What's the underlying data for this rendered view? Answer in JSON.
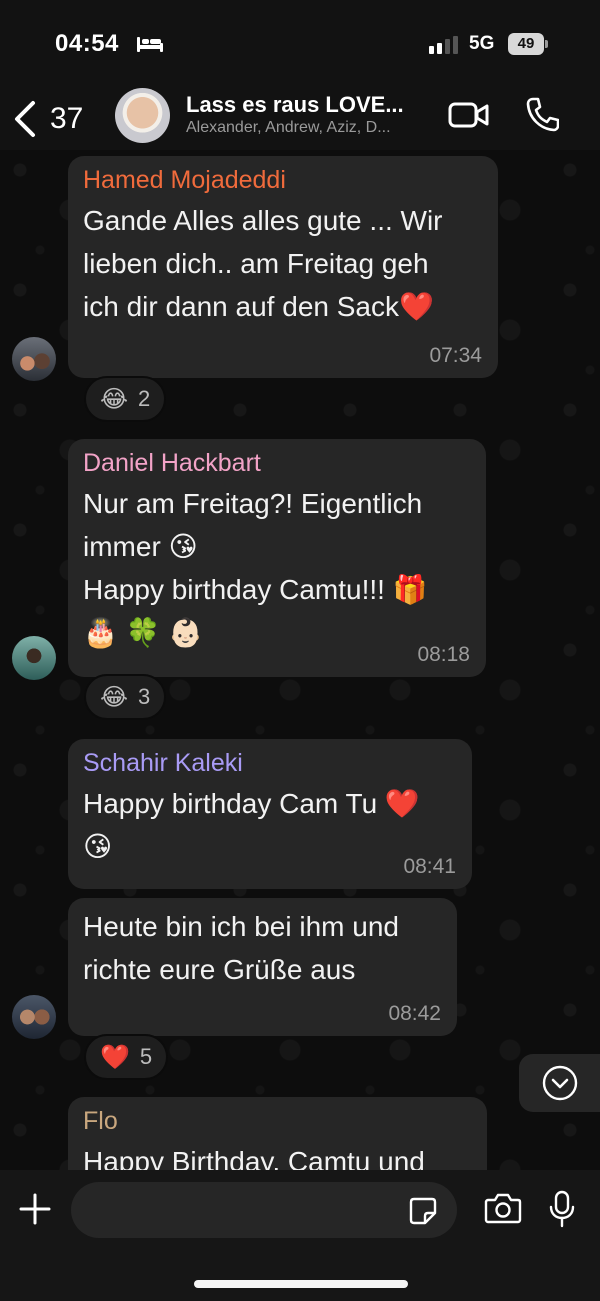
{
  "status": {
    "time": "04:54",
    "network": "5G",
    "battery": "49"
  },
  "header": {
    "back_count": "37",
    "title": "Lass es raus LOVE...",
    "members": "Alexander, Andrew, Aziz, D..."
  },
  "messages": [
    {
      "sender": "Hamed Mojadeddi",
      "sender_color": "#f06b3c",
      "lines": [
        "Gande Alles alles gute ... Wir",
        "lieben dich.. am Freitag geh",
        "ich dir dann auf den Sack❤️"
      ],
      "time": "07:34",
      "reaction": {
        "emoji": "😂",
        "count": "2"
      }
    },
    {
      "sender": "Daniel Hackbart",
      "sender_color": "#f2a3c7",
      "lines": [
        "Nur am Freitag?! Eigentlich",
        "immer 😘",
        "Happy birthday Camtu!!! 🎁",
        "🎂 🍀 👶🏻"
      ],
      "time": "08:18",
      "reaction": {
        "emoji": "😂",
        "count": "3"
      }
    },
    {
      "sender": "Schahir Kaleki",
      "sender_color": "#a99bf5",
      "lines": [
        "Happy birthday Cam Tu ❤️",
        "😘"
      ],
      "time": "08:41"
    },
    {
      "lines": [
        "Heute bin ich bei ihm und",
        "richte eure Grüße aus"
      ],
      "time": "08:42",
      "reaction": {
        "emoji": "❤️",
        "count": "5"
      }
    },
    {
      "sender": "Flo",
      "sender_color": "#c9a77e",
      "lines": [
        "Happy Birthday, Camtu und"
      ]
    }
  ],
  "input": {
    "placeholder": ""
  },
  "icons": {
    "back": "chevron-left-icon",
    "video": "video-camera-icon",
    "call": "phone-icon",
    "plus": "plus-icon",
    "sticker": "sticker-icon",
    "camera": "camera-icon",
    "mic": "microphone-icon",
    "scroll": "chevron-down-circle-icon"
  }
}
